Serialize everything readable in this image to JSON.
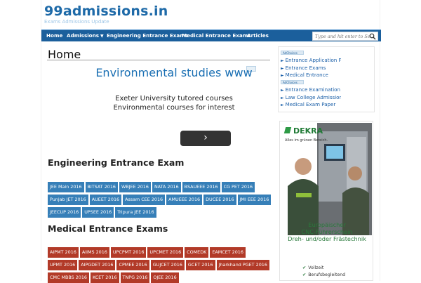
{
  "header": {
    "site_title": "99admissions.in",
    "tagline": "Exams Admissions Update"
  },
  "nav": {
    "items": [
      "Home",
      "Admissions",
      "Engineering Entrance Exams",
      "Medical Entrance Exams",
      "Articles"
    ],
    "search_placeholder": "Type and hit enter to Se"
  },
  "main": {
    "page_title": "Home",
    "ad": {
      "headline": "Environmental studies www",
      "body": "Exeter University tutored courses Environmental courses for interest",
      "next_glyph": "›"
    },
    "engineering": {
      "title": "Engineering Entrance Exam",
      "tags": [
        [
          "JEE Main 2016",
          "BITSAT 2016",
          "WBJEE 2016",
          "NATA 2016",
          "BSAUEEE 2016",
          "CG PET 2016"
        ],
        [
          "Punjab JET 2016",
          "AUEET 2016",
          "Assam CEE 2016",
          "AMUEEE 2016",
          "DUCEE 2016",
          "JMI EEE 2016"
        ],
        [
          "JEECUP 2016",
          "UPSEE 2016",
          "Tripura JEE 2016"
        ]
      ]
    },
    "medical": {
      "title": "Medical Entrance Exams",
      "tags": [
        [
          "AIPMT 2016",
          "AIIMS 2016",
          "UPCPMT 2016",
          "UPCMET 2016",
          "COMEDK",
          "EAMCET 2016"
        ],
        [
          "UPMT 2016",
          "AIPGDET 2016",
          "CPMEE 2016",
          "GUJCET 2016",
          "GCET 2016",
          "Jharkhand PGET 2016"
        ],
        [
          "CMC MBBS 2016",
          "KCET 2016",
          "TNPG 2016",
          "OJEE 2016"
        ]
      ]
    }
  },
  "sidebar": {
    "ad_label": "AdChoices",
    "links_a": [
      "Entrance Application F",
      "Entrance Exams",
      "Medical Entrance"
    ],
    "links_b": [
      "Entrance Examination",
      "Law College Admission",
      "Medical Exam Paper"
    ],
    "dekra": {
      "logo": "DEKRA",
      "slogan": "Alles im grünen Bereich.",
      "copy": [
        "Europäischer",
        "CNC-Führerschein",
        "Dreh- und/oder Frästechnik"
      ],
      "bullets": [
        "Vollzeit",
        "Berufsbegleitend"
      ]
    }
  },
  "colors": {
    "nav_bg": "#1b5f9c",
    "brand_blue": "#1e6aa8",
    "tag_blue": "#367fb8",
    "tag_red": "#b23a28",
    "dekra_green": "#2a7a3c"
  }
}
